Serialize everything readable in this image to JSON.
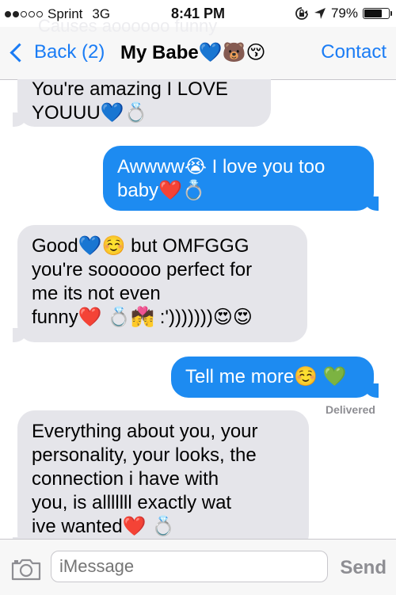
{
  "status_bar": {
    "carrier": "Sprint",
    "network": "3G",
    "time": "8:41 PM",
    "battery_percent_text": "79%",
    "battery_level": 0.79,
    "signal_bars_filled": 2,
    "signal_bars_total": 5
  },
  "nav": {
    "back_label": "Back (2)",
    "title": "My Babe💙🐻😚",
    "contact_label": "Contact",
    "ghost_text_1": "Causes aoooooo funny"
  },
  "messages": [
    {
      "direction": "received",
      "lines": [
        "You're amazing I LOVE",
        "YOUUU💙💍"
      ]
    },
    {
      "direction": "sent",
      "lines": [
        "Awwww😭 I love you too",
        "baby❤️💍"
      ]
    },
    {
      "direction": "received",
      "lines": [
        "Good💙☺️  but OMFGGG",
        "you're soooooo perfect for",
        "me its not even",
        "funny❤️ 💍💏 :')))))))😍😍"
      ]
    },
    {
      "direction": "sent",
      "lines": [
        "Tell me more☺️ 💚"
      ]
    },
    {
      "direction": "received",
      "lines": [
        "Everything about you, your",
        "personality, your looks, the",
        "connection i have with",
        "you, is alllllll exactly wat",
        "ive wanted❤️ 💍"
      ]
    }
  ],
  "delivered_label": "Delivered",
  "input": {
    "placeholder": "iMessage",
    "send_label": "Send"
  },
  "colors": {
    "accent": "#1a7cf5",
    "sent_bubble": "#1d8bf1",
    "received_bubble": "#e5e5ea"
  },
  "icons": [
    "signal-dots-icon",
    "rotation-lock-icon",
    "location-arrow-icon",
    "battery-icon",
    "back-chevron-icon",
    "camera-icon"
  ]
}
